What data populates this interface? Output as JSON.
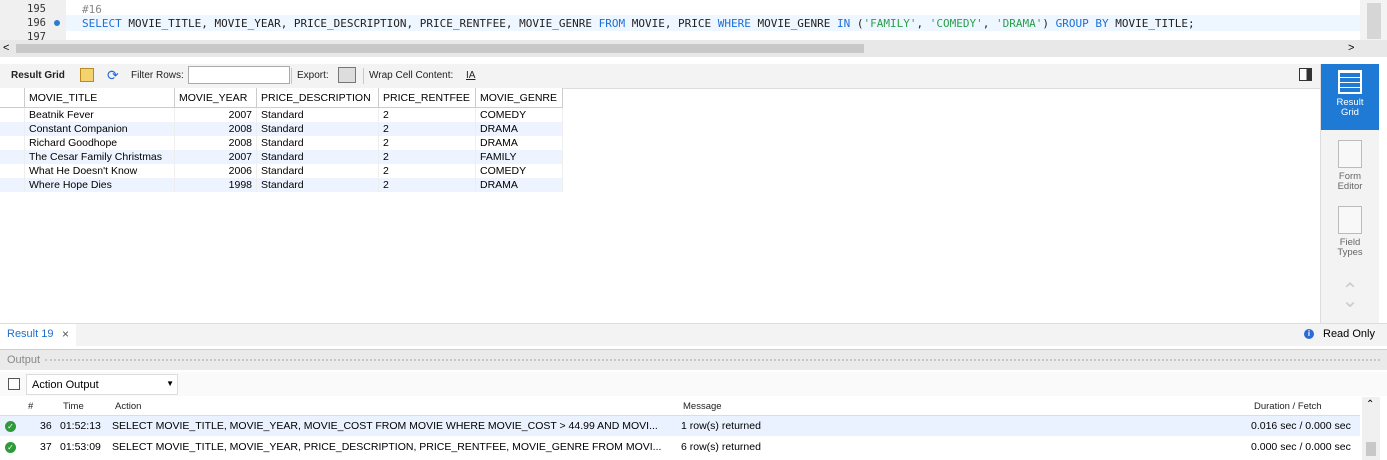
{
  "editor": {
    "lines": [
      {
        "num": "195",
        "text": "#16"
      },
      {
        "num": "196",
        "text": "SELECT MOVIE_TITLE, MOVIE_YEAR, PRICE_DESCRIPTION, PRICE_RENTFEE, MOVIE_GENRE FROM MOVIE, PRICE WHERE MOVIE_GENRE IN ('FAMILY', 'COMEDY', 'DRAMA') GROUP BY MOVIE_TITLE;"
      },
      {
        "num": "197",
        "text": ""
      }
    ],
    "sql_parts": {
      "select": "SELECT",
      "cols": " MOVIE_TITLE, MOVIE_YEAR, PRICE_DESCRIPTION, PRICE_RENTFEE, MOVIE_GENRE ",
      "from": "FROM",
      "tables": " MOVIE, PRICE ",
      "where": "WHERE",
      "field": " MOVIE_GENRE ",
      "in": "IN",
      "open": " (",
      "s1": "'FAMILY'",
      "c1": ", ",
      "s2": "'COMEDY'",
      "c2": ", ",
      "s3": "'DRAMA'",
      "close": ") ",
      "group": "GROUP BY",
      "tail": " MOVIE_TITLE;"
    }
  },
  "toolbar": {
    "result_grid": "Result Grid",
    "filter_rows": "Filter Rows:",
    "filter_value": "",
    "export": "Export:",
    "wrap": "Wrap Cell Content:"
  },
  "grid": {
    "columns": [
      "MOVIE_TITLE",
      "MOVIE_YEAR",
      "PRICE_DESCRIPTION",
      "PRICE_RENTFEE",
      "MOVIE_GENRE"
    ],
    "rows": [
      [
        "Beatnik Fever",
        "2007",
        "Standard",
        "2",
        "COMEDY"
      ],
      [
        "Constant Companion",
        "2008",
        "Standard",
        "2",
        "DRAMA"
      ],
      [
        "Richard Goodhope",
        "2008",
        "Standard",
        "2",
        "DRAMA"
      ],
      [
        "The Cesar Family Christmas",
        "2007",
        "Standard",
        "2",
        "FAMILY"
      ],
      [
        "What He Doesn't Know",
        "2006",
        "Standard",
        "2",
        "COMEDY"
      ],
      [
        "Where Hope Dies",
        "1998",
        "Standard",
        "2",
        "DRAMA"
      ]
    ]
  },
  "right_panel": {
    "result_grid": "Result Grid",
    "form_editor": "Form Editor",
    "field_types": "Field Types"
  },
  "result_tab": {
    "label": "Result 19",
    "close": "×",
    "read_only": "Read Only"
  },
  "output": {
    "header": "Output",
    "selector": "Action Output",
    "columns": [
      "#",
      "Time",
      "Action",
      "Message",
      "Duration / Fetch"
    ],
    "rows": [
      {
        "num": "36",
        "time": "01:52:13",
        "action": "SELECT MOVIE_TITLE, MOVIE_YEAR, MOVIE_COST FROM MOVIE WHERE MOVIE_COST > 44.99 AND MOVI...",
        "message": "1 row(s) returned",
        "duration": "0.016 sec / 0.000 sec"
      },
      {
        "num": "37",
        "time": "01:53:09",
        "action": "SELECT MOVIE_TITLE, MOVIE_YEAR, PRICE_DESCRIPTION, PRICE_RENTFEE, MOVIE_GENRE FROM MOVI...",
        "message": "6 row(s) returned",
        "duration": "0.000 sec / 0.000 sec"
      }
    ]
  }
}
